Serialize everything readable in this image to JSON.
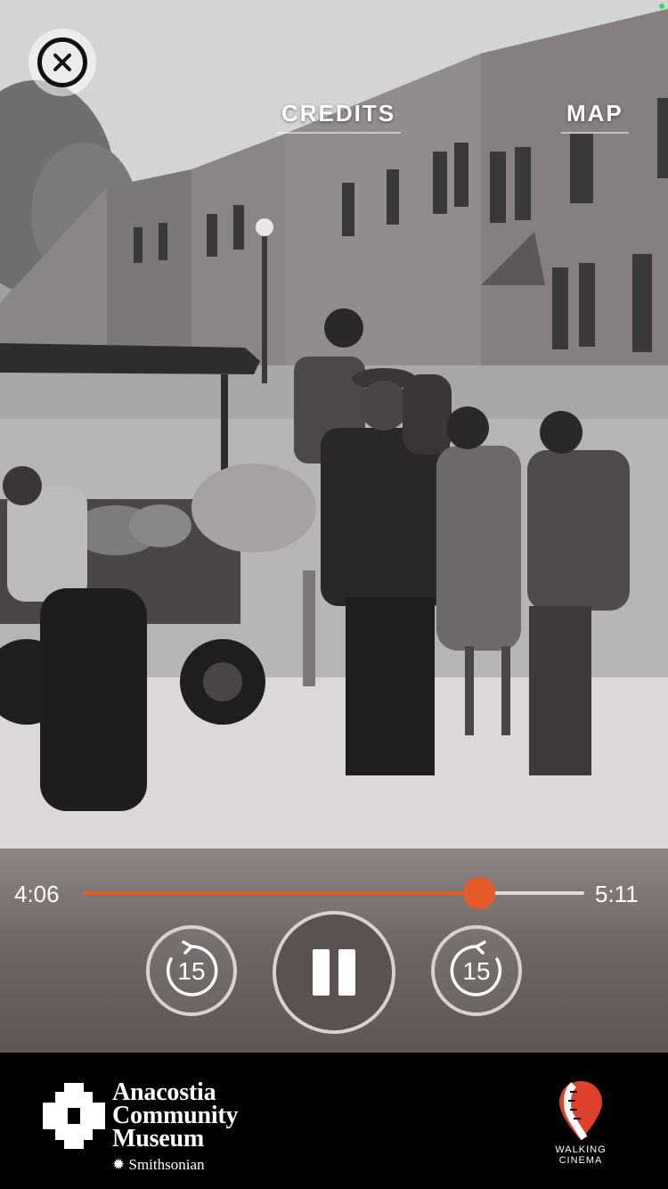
{
  "header": {
    "credits_label": "CREDITS",
    "map_label": "MAP"
  },
  "player": {
    "elapsed": "4:06",
    "duration": "5:11",
    "progress": 0.79,
    "rewind_seconds": "15",
    "forward_seconds": "15",
    "accent_color": "#e55a26"
  },
  "footer": {
    "museum_line1": "Anacostia",
    "museum_line2": "Community",
    "museum_line3": "Museum",
    "museum_sub": "✹ Smithsonian",
    "partner_line1": "WALKING",
    "partner_line2": "CINEMA"
  },
  "icons": {
    "close": "close-icon",
    "rewind": "rewind-15-icon",
    "forward": "forward-15-icon",
    "pause": "pause-icon"
  }
}
